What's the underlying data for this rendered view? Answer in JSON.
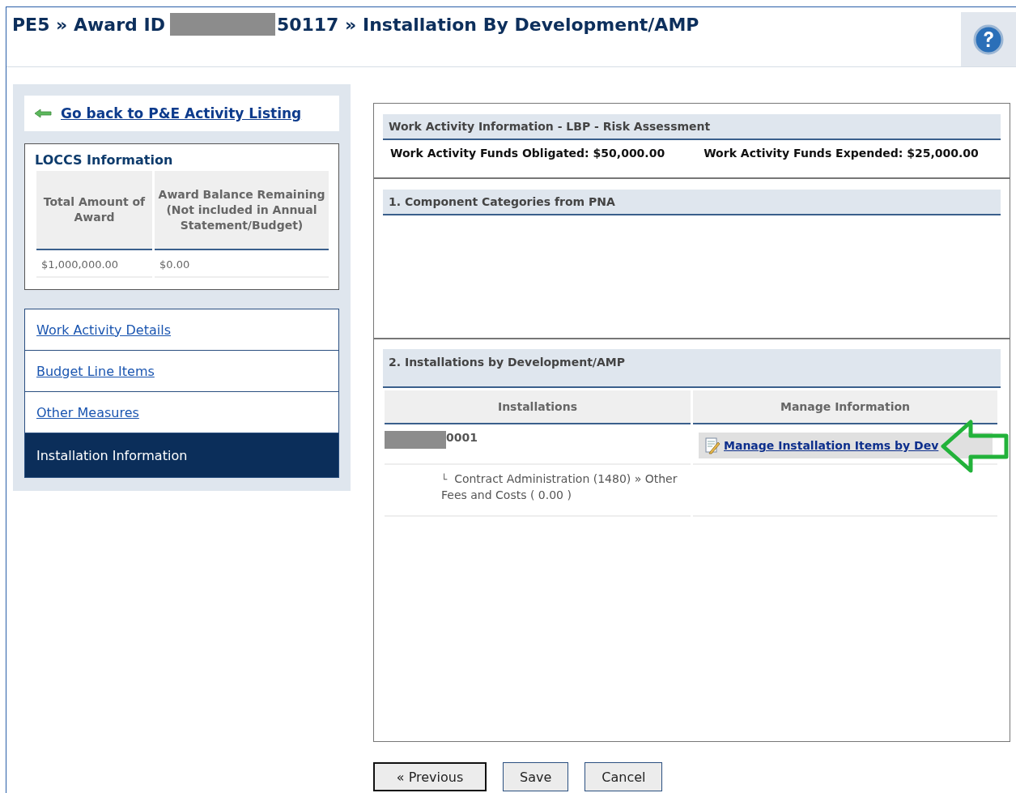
{
  "header": {
    "title_prefix": "PE5 » Award ID",
    "title_suffix": "50117 » Installation By Development/AMP"
  },
  "sidebar": {
    "back_link": "Go back to P&E Activity Listing",
    "loccs": {
      "title": "LOCCS Information",
      "columns": [
        "Total Amount of Award",
        "Award Balance Remaining (Not included in Annual Statement/Budget)"
      ],
      "values": [
        "$1,000,000.00",
        "$0.00"
      ]
    },
    "nav": [
      {
        "label": "Work Activity Details",
        "selected": false
      },
      {
        "label": "Budget Line Items",
        "selected": false
      },
      {
        "label": "Other Measures",
        "selected": false
      },
      {
        "label": "Installation Information",
        "selected": true
      }
    ]
  },
  "work_activity": {
    "title": "Work Activity Information - LBP - Risk Assessment",
    "obligated": "Work Activity Funds Obligated: $50,000.00",
    "expended": "Work Activity Funds Expended: $25,000.00"
  },
  "components": {
    "title": "1. Component Categories from PNA"
  },
  "installations": {
    "title": "2. Installations by Development/AMP",
    "columns": [
      "Installations",
      "Manage Information"
    ],
    "rows": [
      {
        "id_suffix": "0001",
        "action": "Manage Installation Items by Dev",
        "detail_mark": "└",
        "detail": "Contract Administration (1480) » Other Fees and Costs ( 0.00 )"
      }
    ]
  },
  "buttons": [
    {
      "label": "« Previous",
      "selected": true
    },
    {
      "label": "Save",
      "selected": false
    },
    {
      "label": "Cancel",
      "selected": false
    }
  ]
}
